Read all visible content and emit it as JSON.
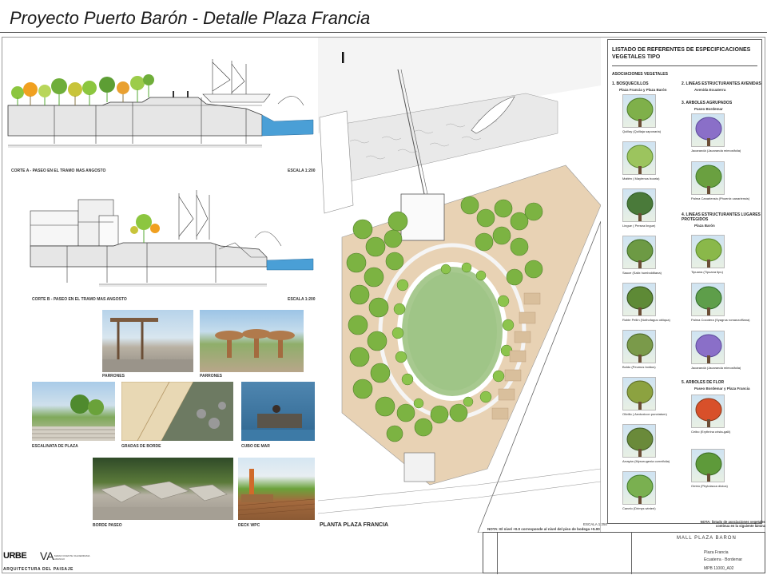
{
  "header": {
    "title": "Proyecto  Puerto Barón - Detalle Plaza Francia"
  },
  "sections": {
    "a_caption": "CORTE A - PASEO EN EL TRAMO MAS ANGOSTO",
    "a_scale": "ESCALA 1:200",
    "b_caption": "CORTE B - PASEO EN EL TRAMO MAS ANGOSTO",
    "b_scale": "ESCALA 1:200"
  },
  "photos": [
    {
      "caption": "PARRONES"
    },
    {
      "caption": "PARRONES"
    },
    {
      "caption": "ESCALINATA DE PLAZA"
    },
    {
      "caption": "GRADAS DE BORDE"
    },
    {
      "caption": "CUBO DE MAR"
    },
    {
      "caption": "BORDE PASEO"
    },
    {
      "caption": "DECK WPC"
    }
  ],
  "plan": {
    "title": "PLANTA PLAZA FRANCIA",
    "scale": "ESCALA 1:250",
    "note": "NOTA: El nivel +0.0 corresponde al nivel del piso de bodega +5.00",
    "species_note": "NOTA: listado de asociaciones vegetales continua en la siguiente lámina"
  },
  "species_panel": {
    "title": "LISTADO DE REFERENTES DE ESPECIFICACIONES VEGETALES TIPO",
    "heading": "ASOCIACIONES VEGETALES",
    "group1": "1. BOSQUECILLOS",
    "group1_sub": "Plaza Francia y Plaza Barón",
    "group2": "2. LINEAS ESTRUCTURANTES AVENIDAS",
    "group2_sub": "Avenida Ecuaterra",
    "group3": "3. ARBOLES AGRUPADOS",
    "group3_sub": "Paseo Bordemar",
    "group4": "4. LINEAS ESTRUCTURANTES LUGARES PROTEGIDOS",
    "group4_sub": "Plaza Barón",
    "group5": "5. ARBOLES DE FLOR",
    "group5_sub": "Paseo Bordemar y Plaza Francia",
    "left_trees": [
      "Quillay (Quillaja saponaria)",
      "Maitén ( Maytenus boaria)",
      "Lingue ( Persea lingue)",
      "Sauce (Salix humboldtiana)",
      "Roble Pellín (Nothofagus obliqua)",
      "Boldo (Peumus boldus)",
      "Olivillo ( Aextoxicon punctatum)",
      "Arrayán (Myrceugenia correifolia)",
      "Canelo (Drimys winteri)"
    ],
    "right_trees": [
      "Jacarandá (Jacaranda mimosifolia)",
      "Palma Canariensis (Phoenix canariensis)",
      "Tipuana (Tipuana tipu)",
      "Palma Cocotera (Syagrus romanzoffiana)",
      "Jacarandá (Jacaranda mimosifolia)",
      "Ceibo (Erythrina crista-galli)",
      "Ombú (Phytolacca dioica)"
    ]
  },
  "title_block": {
    "project": "MALL PLAZA BARON",
    "row1": "Plaza Francia",
    "row2": "Ecuaterra · Bordemar",
    "code": "MPB   11000_A02"
  },
  "logos": {
    "urbe": "URBE",
    "va": "VA",
    "va_small": "MARIA VICENTE VALDERRAMA ARANGO",
    "sub": "ARQUITECTURA DEL PAISAJE"
  }
}
